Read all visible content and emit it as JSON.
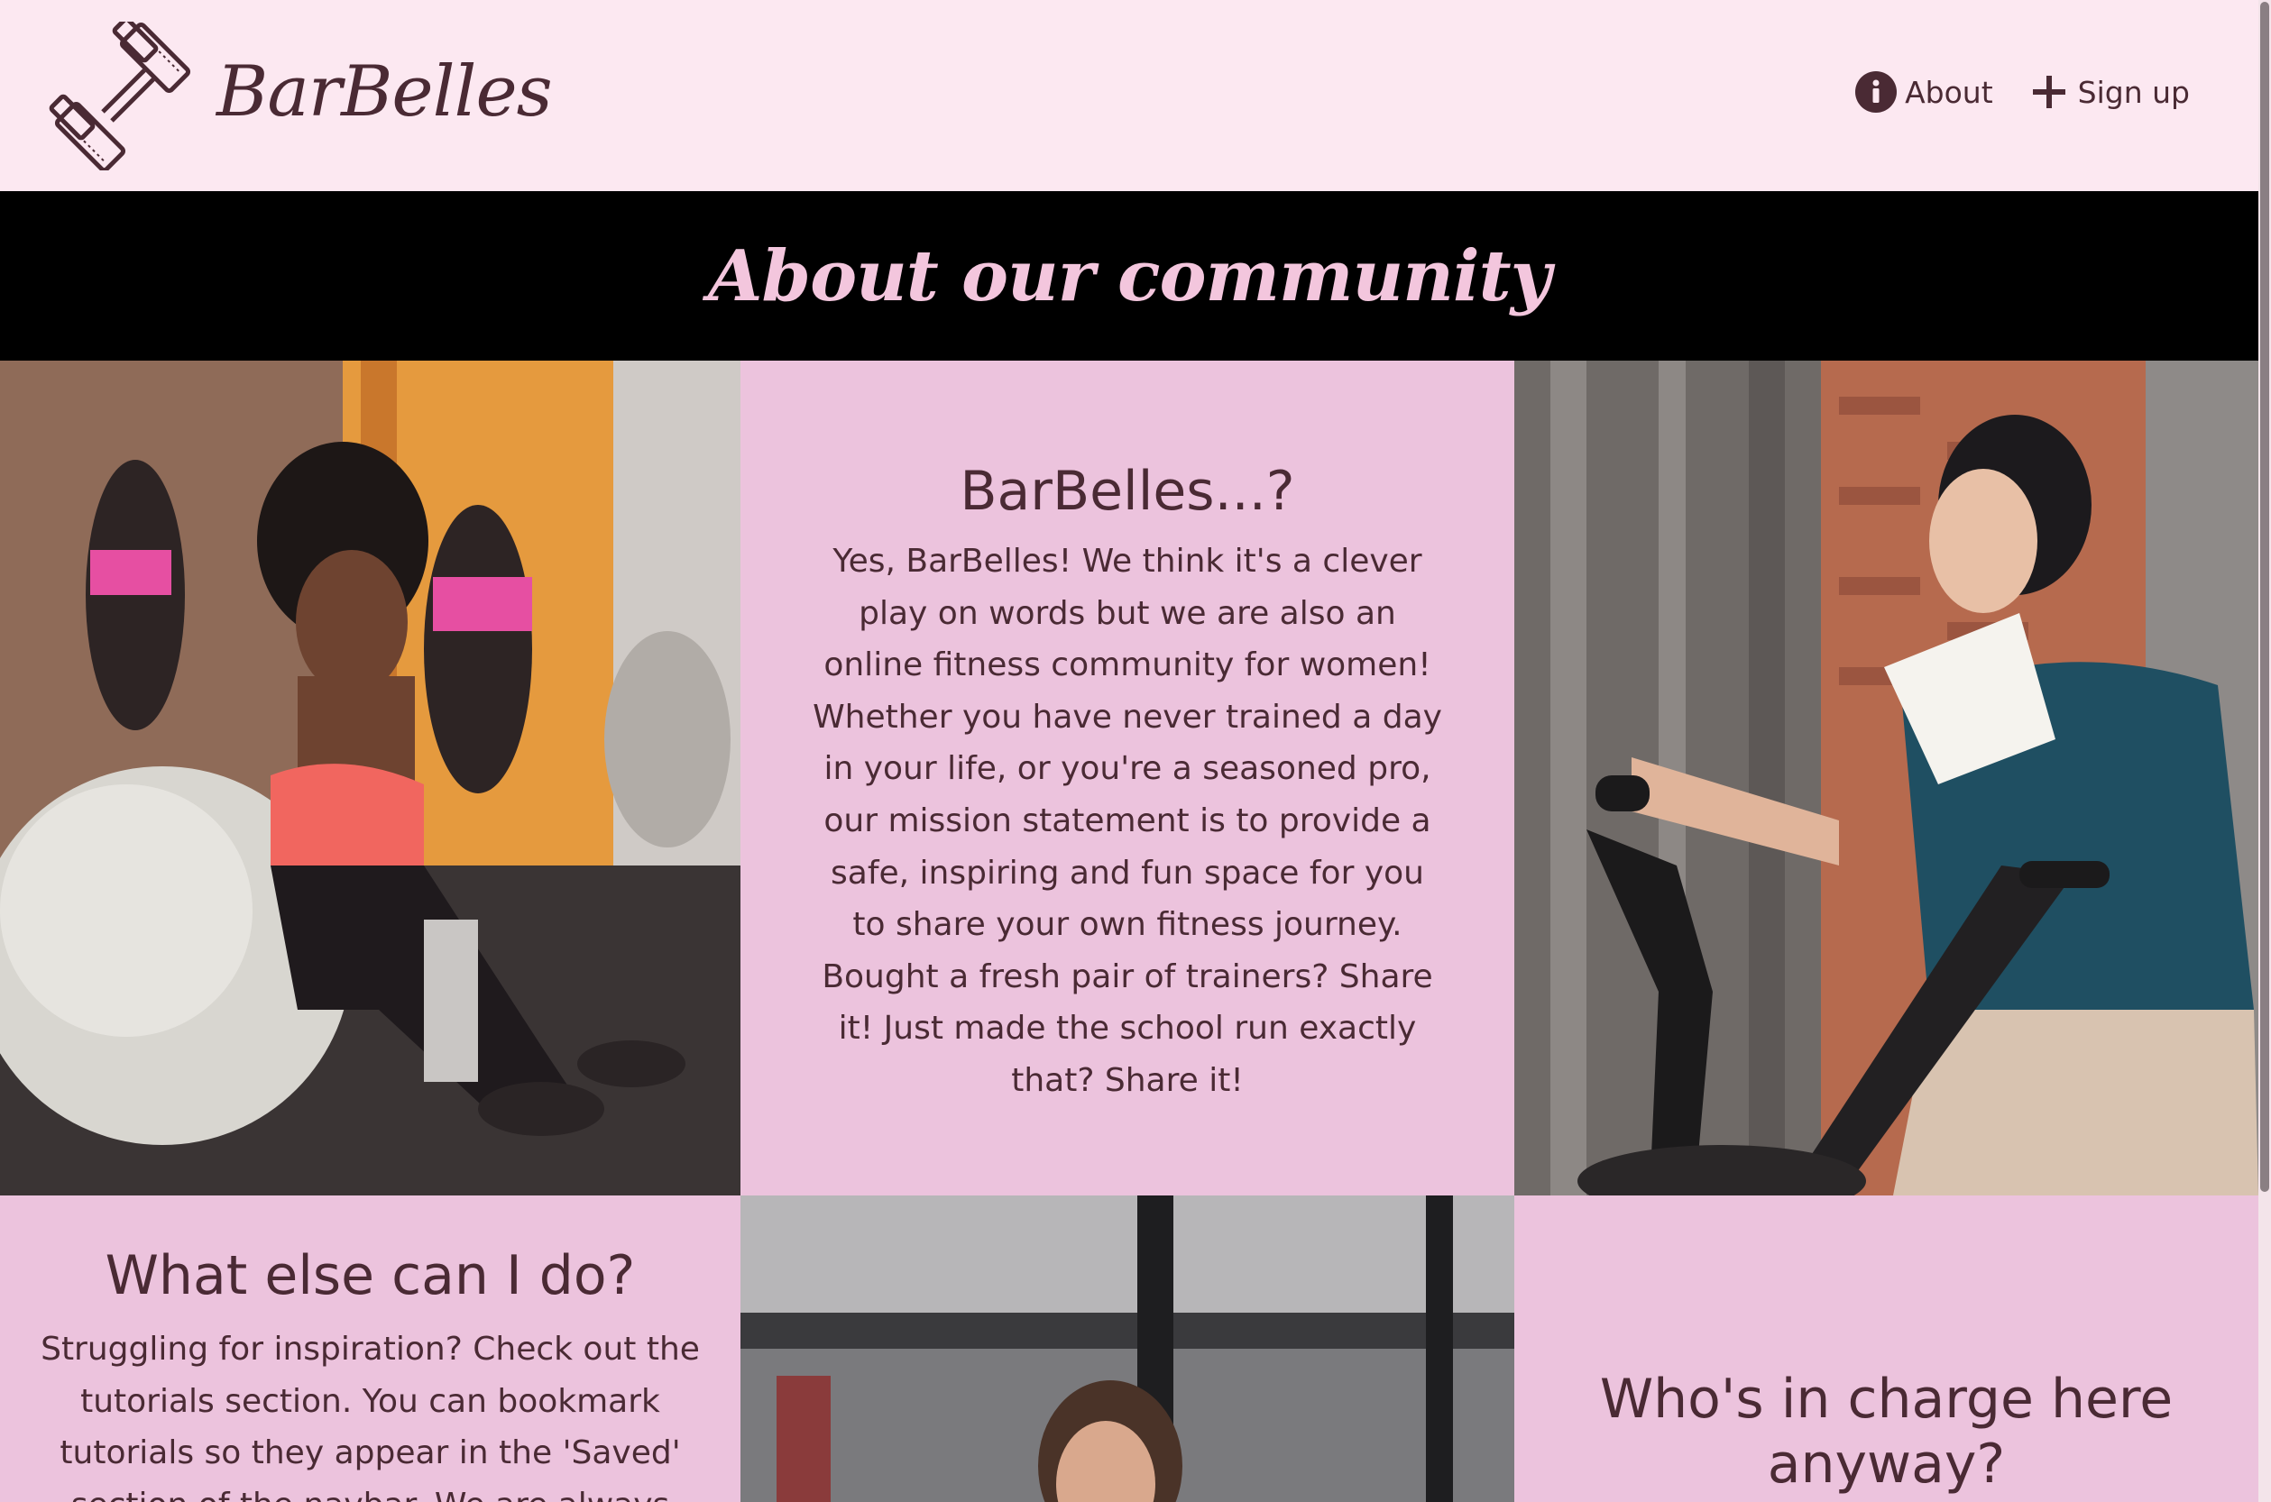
{
  "navbar": {
    "brand_name": "BarBelles",
    "links": [
      {
        "label": "About",
        "icon": "info-circle-icon"
      },
      {
        "label": "Sign up",
        "icon": "plus-icon"
      }
    ]
  },
  "hero": {
    "title": "About our community"
  },
  "sections": {
    "intro": {
      "heading": "BarBelles...?",
      "body": "Yes, BarBelles! We think it's a clever play on words but we are also an online fitness community for women! Whether you have never trained a day in your life, or you're a seasoned pro, our mission statement is to provide a safe, inspiring and fun space for you to share your own fitness journey. Bought a fresh pair of trainers? Share it! Just made the school run exactly that? Share it!"
    },
    "what_else": {
      "heading": "What else can I do?",
      "body": "Struggling for inspiration? Check out the tutorials section. You can bookmark tutorials so they appear in the 'Saved' section of the navbar. We are always"
    },
    "who": {
      "heading": "Who's in charge here anyway?"
    }
  },
  "colors": {
    "navbar_bg": "#fce8f1",
    "hero_bg": "#000000",
    "hero_text": "#f3c6dd",
    "panel_bg": "#ecc3dd",
    "text": "#4a2a34"
  }
}
